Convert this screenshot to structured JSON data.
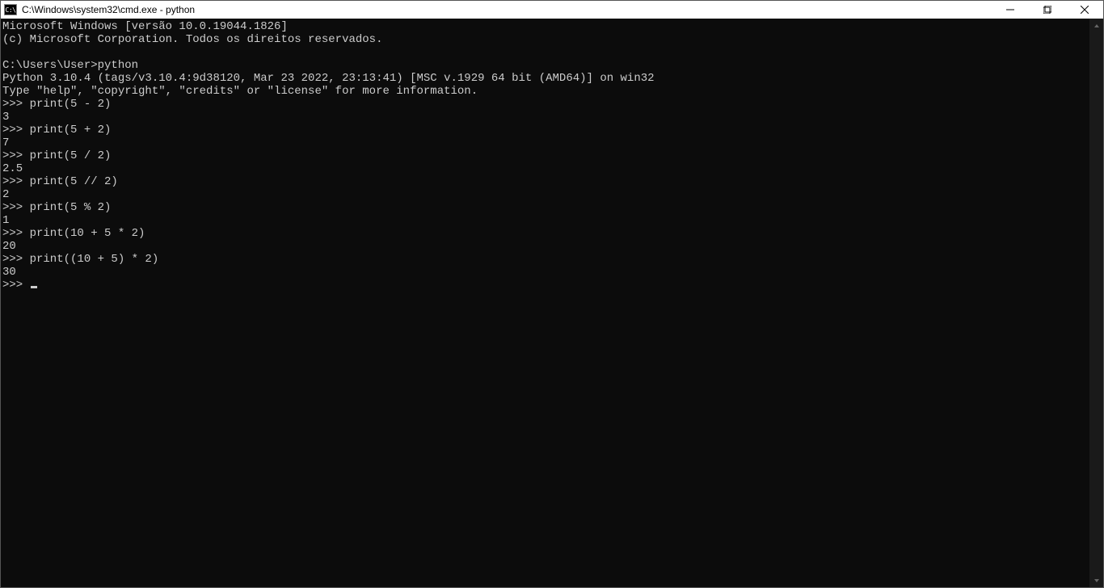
{
  "titlebar": {
    "icon_text": "C:\\",
    "title": "C:\\Windows\\system32\\cmd.exe - python"
  },
  "console": {
    "banner1": "Microsoft Windows [versão 10.0.19044.1826]",
    "banner2": "(c) Microsoft Corporation. Todos os direitos reservados.",
    "blank1": "",
    "prompt_path": "C:\\Users\\User>python",
    "py_banner1": "Python 3.10.4 (tags/v3.10.4:9d38120, Mar 23 2022, 23:13:41) [MSC v.1929 64 bit (AMD64)] on win32",
    "py_banner2": "Type \"help\", \"copyright\", \"credits\" or \"license\" for more information.",
    "repl": [
      {
        "in": ">>> print(5 - 2)",
        "out": "3"
      },
      {
        "in": ">>> print(5 + 2)",
        "out": "7"
      },
      {
        "in": ">>> print(5 / 2)",
        "out": "2.5"
      },
      {
        "in": ">>> print(5 // 2)",
        "out": "2"
      },
      {
        "in": ">>> print(5 % 2)",
        "out": "1"
      },
      {
        "in": ">>> print(10 + 5 * 2)",
        "out": "20"
      },
      {
        "in": ">>> print((10 + 5) * 2)",
        "out": "30"
      }
    ],
    "current_prompt": ">>> "
  }
}
